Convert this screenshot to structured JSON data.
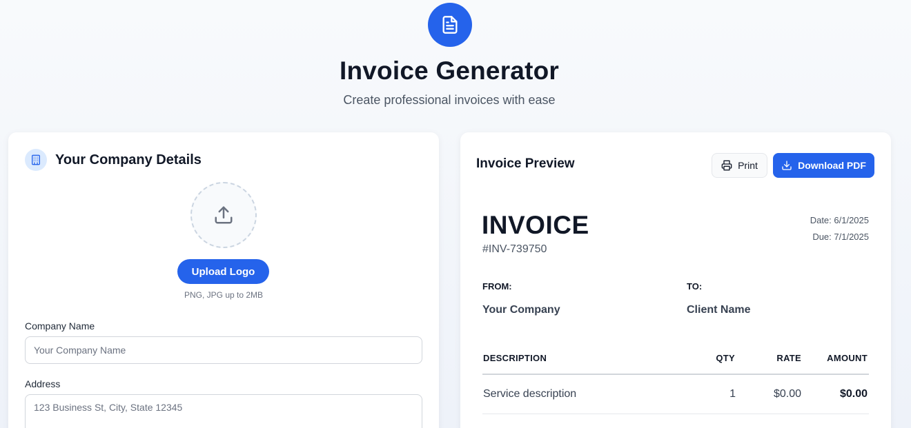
{
  "header": {
    "icon": "document-icon",
    "title": "Invoice Generator",
    "subtitle": "Create professional invoices with ease"
  },
  "company_section": {
    "icon": "building-icon",
    "title": "Your Company Details",
    "upload": {
      "icon": "upload-icon",
      "button_label": "Upload Logo",
      "hint": "PNG, JPG up to 2MB"
    },
    "fields": {
      "company_name": {
        "label": "Company Name",
        "placeholder": "Your Company Name",
        "value": ""
      },
      "address": {
        "label": "Address",
        "placeholder": "123 Business St, City, State 12345",
        "value": ""
      }
    }
  },
  "preview": {
    "title": "Invoice Preview",
    "print_label": "Print",
    "download_label": "Download PDF",
    "invoice": {
      "heading": "INVOICE",
      "number": "#INV-739750",
      "date": "Date: 6/1/2025",
      "due": "Due: 7/1/2025",
      "from_label": "FROM:",
      "from_name": "Your Company",
      "to_label": "TO:",
      "to_name": "Client Name",
      "columns": [
        "DESCRIPTION",
        "QTY",
        "RATE",
        "AMOUNT"
      ],
      "items": [
        {
          "description": "Service description",
          "qty": "1",
          "rate": "$0.00",
          "amount": "$0.00"
        }
      ]
    }
  },
  "colors": {
    "accent": "#2563eb",
    "accent_light": "#dbeafe",
    "text_primary": "#111827",
    "text_secondary": "#4b5563"
  }
}
